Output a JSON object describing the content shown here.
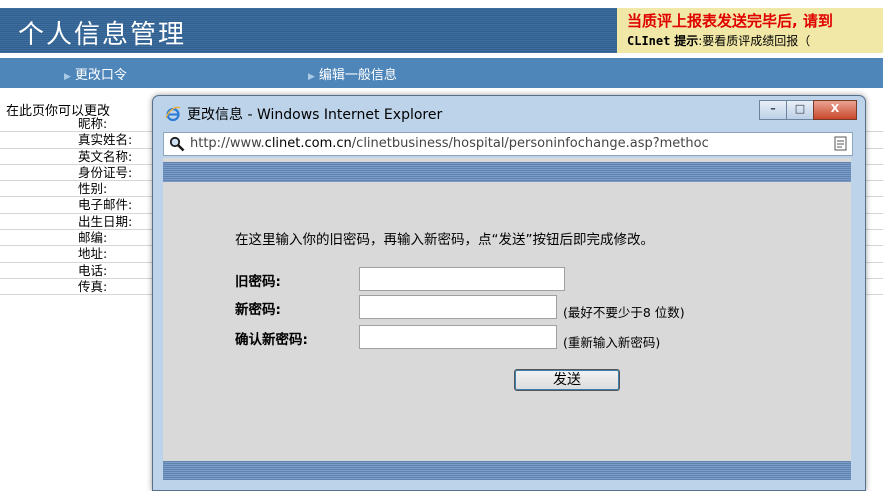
{
  "header": {
    "title": "个人信息管理",
    "notice_red": "当质评上报表发送完毕后, 请到",
    "notice_brand": "CLInet",
    "notice_tip_label": "提示",
    "notice_tip_text": ":要看质评成绩回报（"
  },
  "nav": {
    "items": [
      {
        "label": "更改口令"
      },
      {
        "label": "编辑一般信息"
      }
    ]
  },
  "main": {
    "intro": "在此页你可以更改",
    "fields": [
      "昵称:",
      "真实姓名:",
      "英文名称:",
      "身份证号:",
      "性别:",
      "电子邮件:",
      "出生日期:",
      "邮编:",
      "地址:",
      "电话:",
      "传真:"
    ]
  },
  "popup": {
    "window_title": "更改信息 - Windows Internet Explorer",
    "url_prefix": "http://www.",
    "url_domain": "clinet.com.cn",
    "url_rest": "/clinetbusiness/hospital/personinfochange.asp?methoc",
    "instruction": "在这里输入你的旧密码，再输入新密码，点“发送”按钮后即完成修改。",
    "old_password_label": "旧密码:",
    "new_password_label": "新密码:",
    "new_password_hint": "(最好不要少于8 位数)",
    "confirm_label": "确认新密码:",
    "confirm_hint": "(重新输入新密码)",
    "send_label": "发送",
    "old_password_value": "",
    "new_password_value": "",
    "confirm_value": ""
  },
  "colors": {
    "title_bar": "#3d6e9f",
    "nav_bar": "#4f86b9",
    "notice_bg": "#f1e7a6",
    "notice_red": "#e00000",
    "popup_frame": "#bcd3ea",
    "popup_content": "#d9d9d9"
  },
  "icons": {
    "ie": "internet-explorer-icon",
    "search": "search-icon",
    "page": "page-icon"
  }
}
